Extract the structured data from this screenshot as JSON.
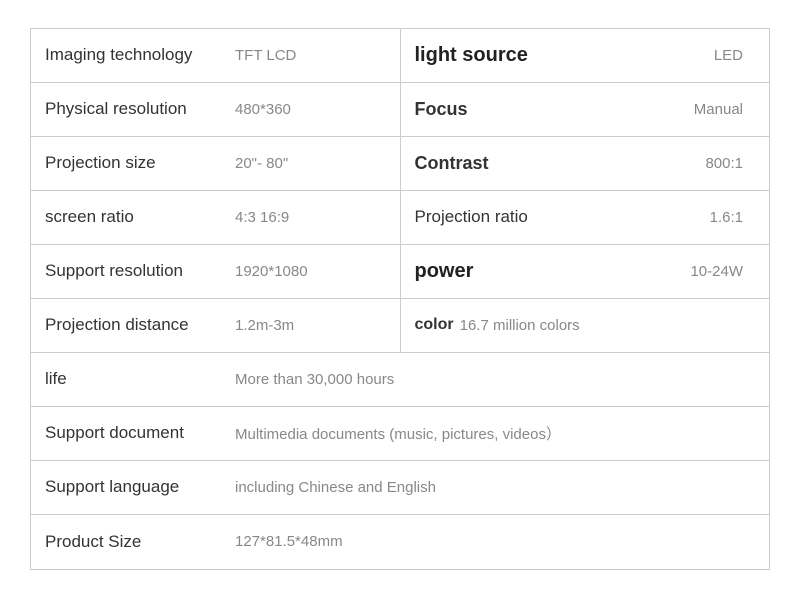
{
  "rows": [
    {
      "type": "split",
      "left_label": "Imaging technology",
      "left_value": "TFT LCD",
      "right_label": "light source",
      "right_value": "LED",
      "right_label_style": "bold"
    },
    {
      "type": "split",
      "left_label": "Physical resolution",
      "left_value": "480*360",
      "right_label": "Focus",
      "right_value": "Manual",
      "right_label_style": "medium"
    },
    {
      "type": "split",
      "left_label": "Projection size",
      "left_value": "20\"- 80\"",
      "right_label": "Contrast",
      "right_value": "800:1",
      "right_label_style": "medium"
    },
    {
      "type": "split",
      "left_label": "screen ratio",
      "left_value": "4:3  16:9",
      "right_label": "Projection ratio",
      "right_value": "1.6:1",
      "right_label_style": "normal"
    },
    {
      "type": "split",
      "left_label": "Support resolution",
      "left_value": "1920*1080",
      "right_label": "power",
      "right_value": "10-24W",
      "right_label_style": "bold"
    },
    {
      "type": "split",
      "left_label": "Projection distance",
      "left_value": "1.2m-3m",
      "right_label": "color",
      "right_inline_value": "16.7 million colors",
      "right_label_style": "inline-bold"
    },
    {
      "type": "full",
      "left_label": "life",
      "left_value": "More than 30,000 hours"
    },
    {
      "type": "full",
      "left_label": "Support document",
      "left_value": "Multimedia documents (music, pictures, videos）"
    },
    {
      "type": "full",
      "left_label": "Support language",
      "left_value": "including Chinese and English"
    },
    {
      "type": "full",
      "left_label": "Product Size",
      "left_value": "127*81.5*48mm"
    }
  ]
}
